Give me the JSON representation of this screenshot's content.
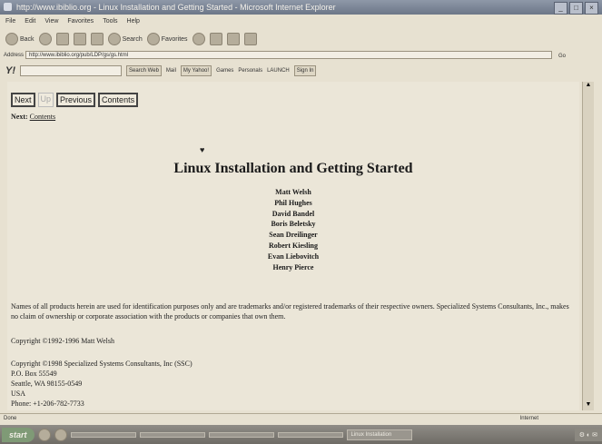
{
  "window": {
    "title": "http://www.ibiblio.org - Linux Installation and Getting Started - Microsoft Internet Explorer"
  },
  "menu": [
    "File",
    "Edit",
    "View",
    "Favorites",
    "Tools",
    "Help"
  ],
  "toolbar": {
    "back": "Back",
    "search": "Search",
    "favorites": "Favorites"
  },
  "address": {
    "label": "Address",
    "url": "http://www.ibiblio.org/pub/LDP/gs/gs.html",
    "go": "Go"
  },
  "yahoo": {
    "logo": "Y!",
    "search_btn": "Search Web",
    "mail": "Mail",
    "myyahoo": "My Yahoo!",
    "games": "Games",
    "personals": "Personals",
    "launch": "LAUNCH",
    "signin": "Sign In"
  },
  "page": {
    "nav": {
      "next": "Next",
      "up": "Up",
      "previous": "Previous",
      "contents": "Contents"
    },
    "next_label": "Next:",
    "next_link": "Contents",
    "title": "Linux Installation and Getting Started",
    "authors": [
      "Matt Welsh",
      "Phil Hughes",
      "David Bandel",
      "Boris Beletsky",
      "Sean Dreilinger",
      "Robert Kiesling",
      "Evan Liebovitch",
      "Henry Pierce"
    ],
    "legal": "Names of all products herein are used for identification purposes only and are trademarks and/or registered trademarks of their respective owners. Specialized Systems Consultants, Inc., makes no claim of ownership or corporate association with the products or companies that own them.",
    "copyright1": "Copyright ©1992-1996 Matt Welsh",
    "copyright2": [
      "Copyright ©1998 Specialized Systems Consultants, Inc (SSC)",
      "P.O. Box 55549",
      "Seattle, WA 98155-0549",
      "USA",
      "Phone: +1-206-782-7733"
    ]
  },
  "status": {
    "left": "Done",
    "right": "Internet"
  },
  "taskbar": {
    "start": "start",
    "tasks": [
      "",
      "",
      "",
      "",
      "Linux Installation"
    ]
  }
}
